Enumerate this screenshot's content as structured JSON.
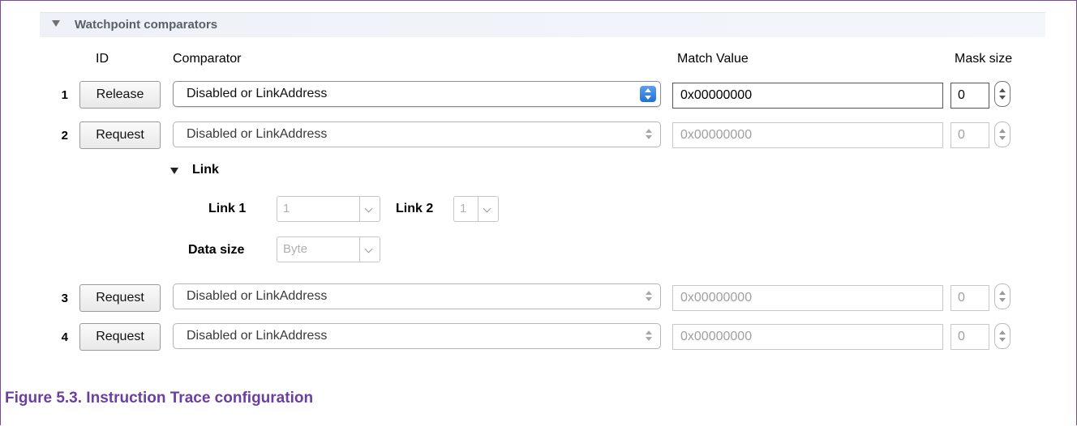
{
  "section": {
    "title": "Watchpoint comparators"
  },
  "columns": {
    "id": "ID",
    "comparator": "Comparator",
    "match_value": "Match Value",
    "mask_size": "Mask size"
  },
  "rows": [
    {
      "num": "1",
      "button": "Release",
      "comparator": "Disabled or LinkAddress",
      "match_value": "0x00000000",
      "mask": "0",
      "enabled": true
    },
    {
      "num": "2",
      "button": "Request",
      "comparator": "Disabled or LinkAddress",
      "match_value": "0x00000000",
      "mask": "0",
      "enabled": false
    },
    {
      "num": "3",
      "button": "Request",
      "comparator": "Disabled or LinkAddress",
      "match_value": "0x00000000",
      "mask": "0",
      "enabled": false
    },
    {
      "num": "4",
      "button": "Request",
      "comparator": "Disabled or LinkAddress",
      "match_value": "0x00000000",
      "mask": "0",
      "enabled": false
    }
  ],
  "link": {
    "title": "Link",
    "link1_label": "Link 1",
    "link1_value": "1",
    "link2_label": "Link 2",
    "link2_value": "1",
    "data_size_label": "Data size",
    "data_size_value": "Byte"
  },
  "caption": "Figure 5.3. Instruction Trace configuration",
  "colors": {
    "frame": "#7a4a9a",
    "caption": "#6b3fa0",
    "accent": "#1f6fd8"
  }
}
